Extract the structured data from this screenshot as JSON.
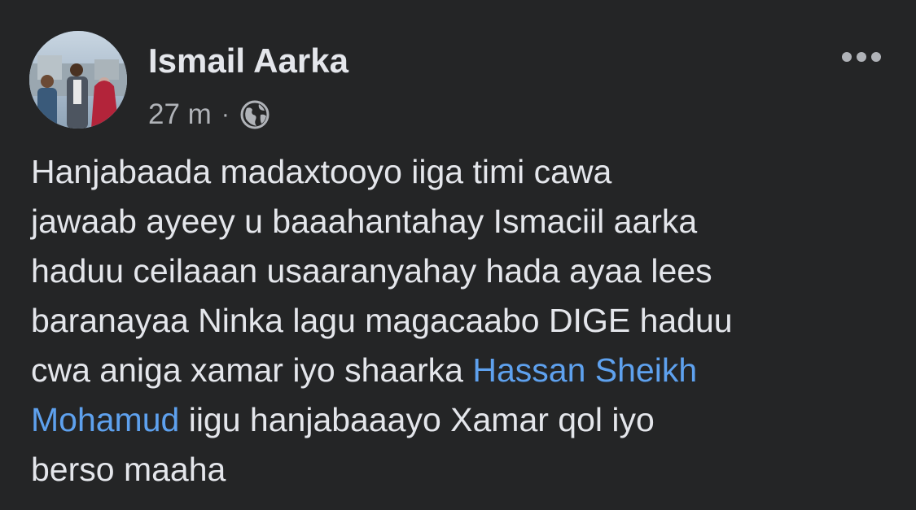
{
  "post": {
    "author": {
      "name": "Ismail Aarka"
    },
    "timestamp": "27 m",
    "separator": "·",
    "privacy_icon": "globe-icon",
    "more_icon": "more-horizontal-icon",
    "text_lines": [
      {
        "parts": [
          {
            "text": "Hanjabaada madaxtooyo iiga timi cawa",
            "mention": false
          }
        ]
      },
      {
        "parts": [
          {
            "text": "jawaab ayeey u baaahantahay Ismaciil aarka",
            "mention": false
          }
        ]
      },
      {
        "parts": [
          {
            "text": "haduu ceilaaan usaaranyahay hada ayaa lees",
            "mention": false
          }
        ]
      },
      {
        "parts": [
          {
            "text": "baranayaa Ninka lagu magacaabo DIGE haduu",
            "mention": false
          }
        ]
      },
      {
        "parts": [
          {
            "text": "cwa aniga xamar iyo shaarka ",
            "mention": false
          },
          {
            "text": "Hassan Sheikh",
            "mention": true
          }
        ]
      },
      {
        "parts": [
          {
            "text": "Mohamud",
            "mention": true
          },
          {
            "text": " iigu hanjabaaayo Xamar qol iyo",
            "mention": false
          }
        ]
      },
      {
        "parts": [
          {
            "text": "berso maaha",
            "mention": false
          }
        ]
      }
    ]
  },
  "colors": {
    "background": "#242526",
    "primary_text": "#e4e6eb",
    "secondary_text": "#b0b3b8",
    "mention": "#5ea1ee"
  }
}
